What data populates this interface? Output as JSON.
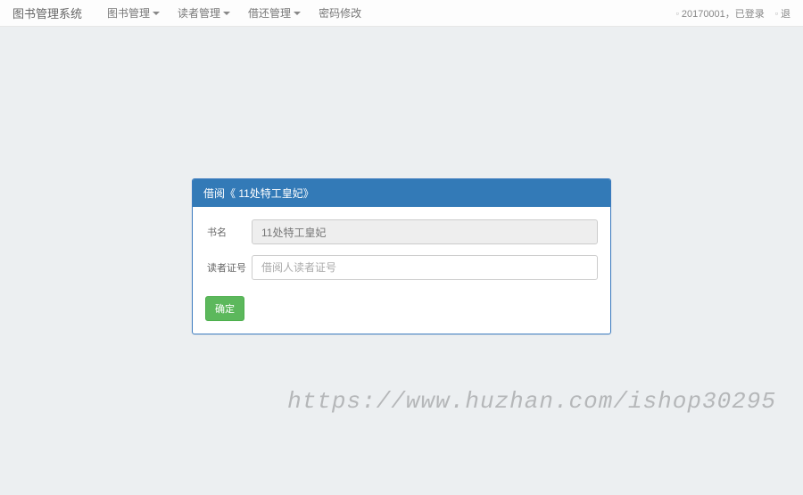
{
  "navbar": {
    "brand": "图书管理系统",
    "menus": [
      {
        "label": "图书管理",
        "dropdown": true
      },
      {
        "label": "读者管理",
        "dropdown": true
      },
      {
        "label": "借还管理",
        "dropdown": true
      },
      {
        "label": "密码修改",
        "dropdown": false
      }
    ],
    "right": {
      "user_status": "20170001，已登录",
      "logout": "退"
    }
  },
  "panel": {
    "title": "借阅《 11处特工皇妃》",
    "fields": {
      "book_name": {
        "label": "书名",
        "value": "11处特工皇妃"
      },
      "reader_id": {
        "label": "读者证号",
        "placeholder": "借阅人读者证号"
      }
    },
    "submit_label": "确定"
  },
  "watermark": "https://www.huzhan.com/ishop30295"
}
